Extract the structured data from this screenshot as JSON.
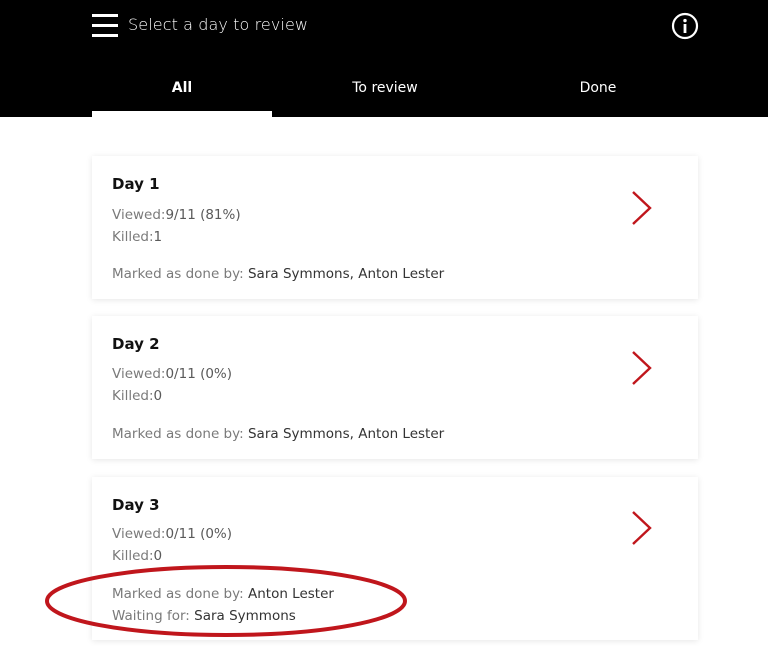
{
  "header": {
    "title": "Select a day to review",
    "menu_icon": "hamburger-menu-icon",
    "info_icon": "info-circle-icon",
    "text_color": "#ffffff",
    "background": "#000000"
  },
  "tabs": [
    {
      "label": "All",
      "active": true
    },
    {
      "label": "To review",
      "active": false
    },
    {
      "label": "Done",
      "active": false
    }
  ],
  "accent_color": "#c0161c",
  "cards": [
    {
      "title": "Day 1",
      "viewed_label": "Viewed:",
      "viewed_value": "9/11 (81%)",
      "killed_label": "Killed:",
      "killed_value": "1",
      "marked_label": "Marked as done by:",
      "marked_value": "Sara Symmons, Anton Lester"
    },
    {
      "title": "Day 2",
      "viewed_label": "Viewed:",
      "viewed_value": "0/11 (0%)",
      "killed_label": "Killed:",
      "killed_value": "0",
      "marked_label": "Marked as done by:",
      "marked_value": "Sara Symmons, Anton Lester"
    },
    {
      "title": "Day 3",
      "viewed_label": "Viewed:",
      "viewed_value": "0/11 (0%)",
      "killed_label": "Killed:",
      "killed_value": "0",
      "marked_label": "Marked as done by:",
      "marked_value": "Anton Lester",
      "waiting_label": "Waiting for:",
      "waiting_value": "Sara Symmons"
    }
  ]
}
